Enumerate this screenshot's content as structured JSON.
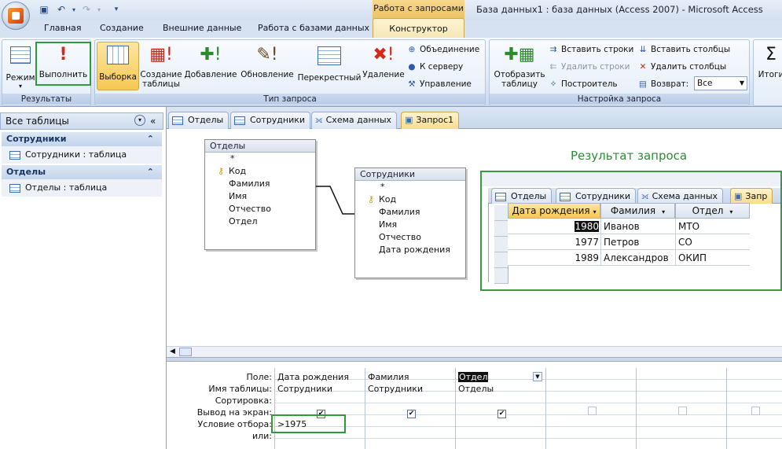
{
  "window": {
    "title": "База данных1 : база данных (Access 2007) - Microsoft Access",
    "context_tab_title": "Работа с запросами"
  },
  "ribbon_tabs": [
    "Главная",
    "Создание",
    "Внешние данные",
    "Работа с базами данных",
    "Конструктор"
  ],
  "groups": {
    "results": {
      "label": "Результаты",
      "mode": "Режим",
      "run": "Выполнить"
    },
    "query_type": {
      "label": "Тип запроса",
      "select": "Выборка",
      "make_table": "Создание таблицы",
      "append": "Добавление",
      "update": "Обновление",
      "crosstab": "Перекрестный",
      "delete": "Удаление",
      "union": "Объединение",
      "passthrough": "К серверу",
      "ddl": "Управление"
    },
    "setup": {
      "label": "Настройка запроса",
      "show_table": "Отобразить таблицу",
      "insert_rows": "Вставить строки",
      "delete_rows": "Удалить строки",
      "builder": "Построитель",
      "insert_cols": "Вставить столбцы",
      "delete_cols": "Удалить столбцы",
      "return_label": "Возврат:",
      "return_value": "Все"
    },
    "totals": {
      "label": "Итоги"
    }
  },
  "nav": {
    "header": "Все таблицы",
    "groups": [
      {
        "name": "Сотрудники",
        "item": "Сотрудники : таблица"
      },
      {
        "name": "Отделы",
        "item": "Отделы : таблица"
      }
    ]
  },
  "doc_tabs": [
    "Отделы",
    "Сотрудники",
    "Схема данных",
    "Запрос1"
  ],
  "tables": {
    "otdely": {
      "title": "Отделы",
      "fields": [
        "*",
        "Код",
        "Фамилия",
        "Имя",
        "Отчество",
        "Отдел"
      ]
    },
    "sotrudniki": {
      "title": "Сотрудники",
      "fields": [
        "*",
        "Код",
        "Фамилия",
        "Имя",
        "Отчество",
        "Дата рождения"
      ]
    }
  },
  "qbe": {
    "row_labels": [
      "Поле:",
      "Имя таблицы:",
      "Сортировка:",
      "Вывод на экран:",
      "Условие отбора:",
      "или:"
    ],
    "columns": [
      {
        "field": "Дата рождения",
        "table": "Сотрудники",
        "show": true,
        "criteria": ">1975"
      },
      {
        "field": "Фамилия",
        "table": "Сотрудники",
        "show": true,
        "criteria": ""
      },
      {
        "field": "Отдел",
        "table": "Отделы",
        "show": true,
        "criteria": ""
      },
      {
        "field": "",
        "table": "",
        "show": false,
        "criteria": ""
      },
      {
        "field": "",
        "table": "",
        "show": false,
        "criteria": ""
      },
      {
        "field": "",
        "table": "",
        "show": false,
        "criteria": ""
      }
    ]
  },
  "result": {
    "label": "Результат запроса",
    "tabs": [
      "Отделы",
      "Сотрудники",
      "Схема данных",
      "Запр"
    ],
    "headers": [
      "Дата рождения",
      "Фамилия",
      "Отдел"
    ],
    "rows": [
      [
        "1980",
        "Иванов",
        "МТО"
      ],
      [
        "1977",
        "Петров",
        "СО"
      ],
      [
        "1989",
        "Александров",
        "ОКИП"
      ]
    ]
  }
}
